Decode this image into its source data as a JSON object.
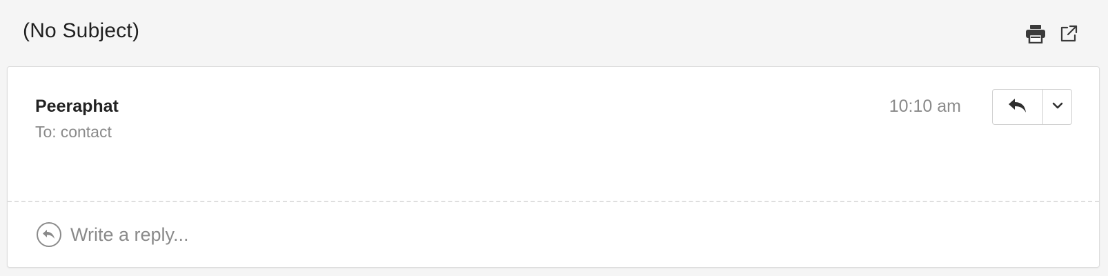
{
  "header": {
    "subject": "(No Subject)",
    "icons": [
      "print-icon",
      "open-external-icon"
    ]
  },
  "message": {
    "sender": "Peeraphat",
    "to_label": "To:",
    "to_name": "contact",
    "time": "10:10 am",
    "actions": {
      "reply_icon": "reply-arrow-icon",
      "more_icon": "chevron-down-icon"
    }
  },
  "reply_box": {
    "placeholder": "Write a reply...",
    "icon": "reply-circle-icon"
  },
  "colors": {
    "background": "#f5f5f5",
    "card": "#ffffff",
    "muted_text": "#8a8a8a",
    "icon": "#3a3a3a"
  }
}
